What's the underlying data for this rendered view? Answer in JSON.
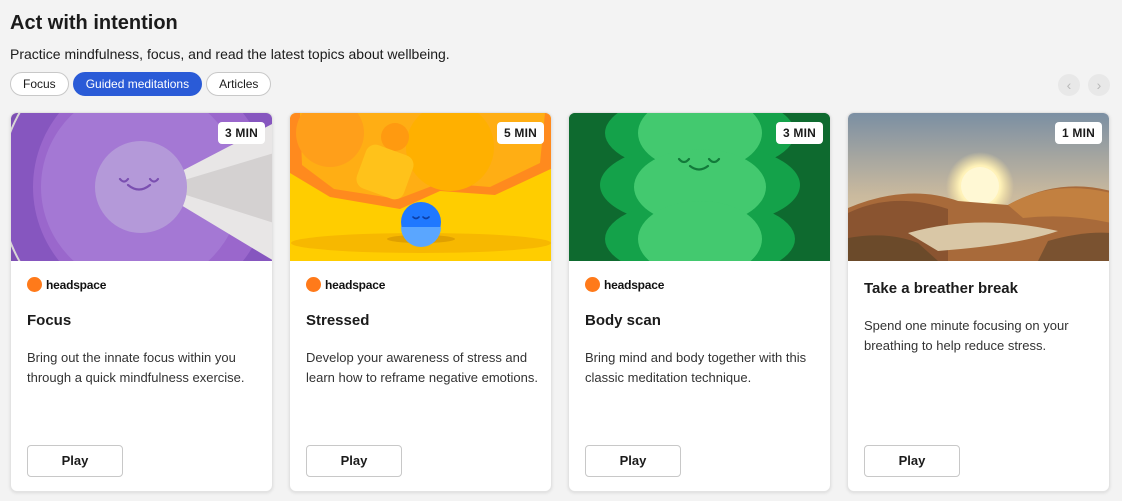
{
  "header": {
    "title": "Act with intention",
    "subtitle": "Practice mindfulness, focus, and read the latest topics about wellbeing."
  },
  "filters": [
    {
      "label": "Focus",
      "active": false
    },
    {
      "label": "Guided meditations",
      "active": true
    },
    {
      "label": "Articles",
      "active": false
    }
  ],
  "nav": {
    "prev_icon": "‹",
    "next_icon": "›"
  },
  "cards": [
    {
      "duration": "3 MIN",
      "brand": "headspace",
      "title": "Focus",
      "description": "Bring out the innate focus within you through a quick mindfulness exercise.",
      "play_label": "Play"
    },
    {
      "duration": "5 MIN",
      "brand": "headspace",
      "title": "Stressed",
      "description": "Develop your awareness of stress and learn how to reframe negative emotions.",
      "play_label": "Play"
    },
    {
      "duration": "3 MIN",
      "brand": "headspace",
      "title": "Body scan",
      "description": "Bring mind and body together with this classic meditation technique.",
      "play_label": "Play"
    },
    {
      "duration": "1 MIN",
      "title": "Take a breather break",
      "description": "Spend one minute focusing on your breathing to help reduce stress.",
      "play_label": "Play"
    }
  ],
  "colors": {
    "accent": "#2a5bd7",
    "headspace_orange": "#ff7a1a"
  }
}
